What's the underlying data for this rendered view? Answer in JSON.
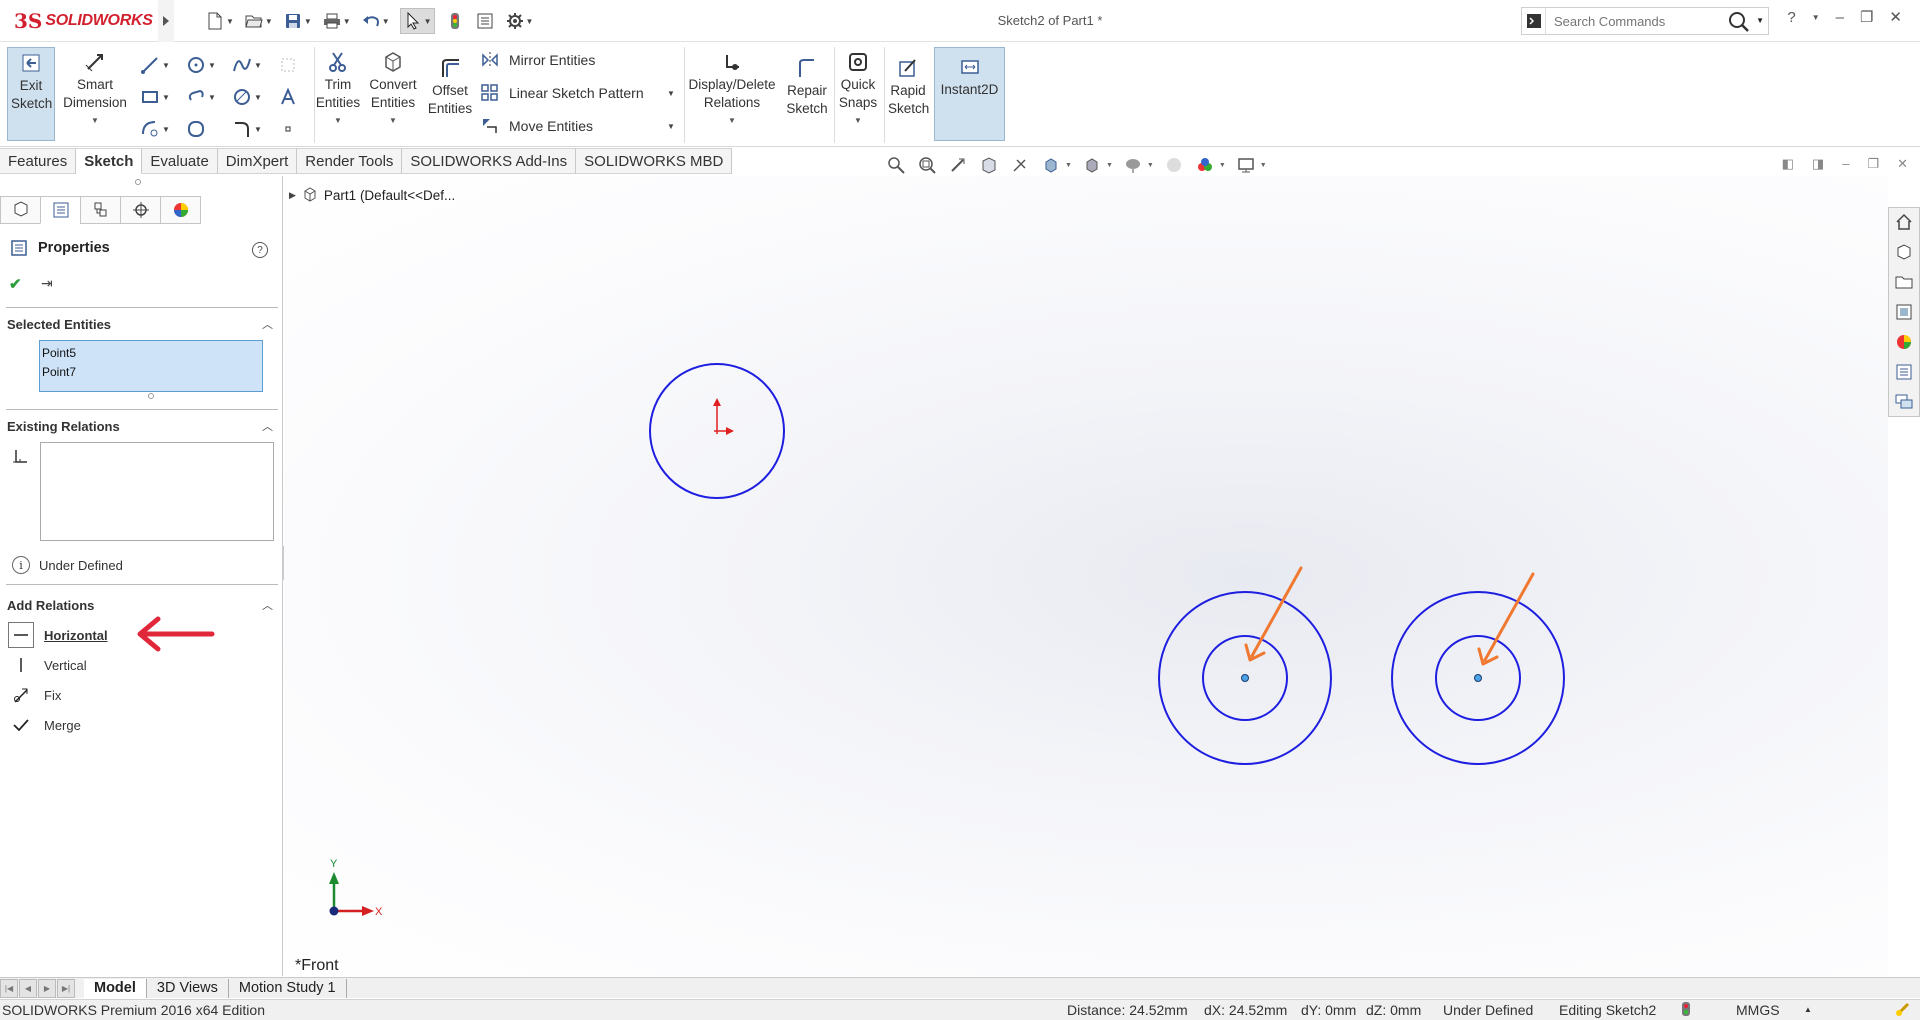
{
  "app": {
    "brand_ds": "3S",
    "brand_name": "SOLIDWORKS",
    "doc_title": "Sketch2 of Part1 *"
  },
  "search": {
    "placeholder": "Search Commands"
  },
  "ribbon": {
    "exit_sketch": "Exit Sketch",
    "smart_dimension": "Smart Dimension",
    "trim_entities": "Trim Entities",
    "convert_entities": "Convert Entities",
    "offset_entities": "Offset Entities",
    "mirror_entities": "Mirror Entities",
    "linear_sketch_pattern": "Linear Sketch Pattern",
    "move_entities": "Move Entities",
    "display_delete_relations": "Display/Delete Relations",
    "repair_sketch": "Repair Sketch",
    "quick_snaps": "Quick Snaps",
    "rapid_sketch": "Rapid Sketch",
    "instant2d": "Instant2D"
  },
  "tabs": [
    "Features",
    "Sketch",
    "Evaluate",
    "DimXpert",
    "Render Tools",
    "SOLIDWORKS Add-Ins",
    "SOLIDWORKS MBD"
  ],
  "panel": {
    "title": "Properties",
    "selected_entities": {
      "header": "Selected Entities",
      "items": [
        "Point5",
        "Point7"
      ]
    },
    "existing_relations": {
      "header": "Existing Relations"
    },
    "status": "Under Defined",
    "add_relations": {
      "header": "Add Relations",
      "items": [
        "Horizontal",
        "Vertical",
        "Fix",
        "Merge"
      ]
    }
  },
  "tree": {
    "part_label": "Part1  (Default<<Def..."
  },
  "viewport": {
    "view_label": "*Front",
    "axis_x": "X",
    "axis_y": "Y"
  },
  "bottom_tabs": [
    "Model",
    "3D Views",
    "Motion Study 1"
  ],
  "statusbar": {
    "edition": "SOLIDWORKS Premium 2016 x64 Edition",
    "distance": "Distance: 24.52mm",
    "dx": "dX: 24.52mm",
    "dy": "dY: 0mm",
    "dz": "dZ: 0mm",
    "state": "Under Defined",
    "editing": "Editing Sketch2",
    "units": "MMGS"
  },
  "colors": {
    "sketch_blue": "#1e1ee0",
    "annotation_orange": "#f07830",
    "annotation_red": "#e0283a",
    "brand_red": "#d3202f"
  }
}
